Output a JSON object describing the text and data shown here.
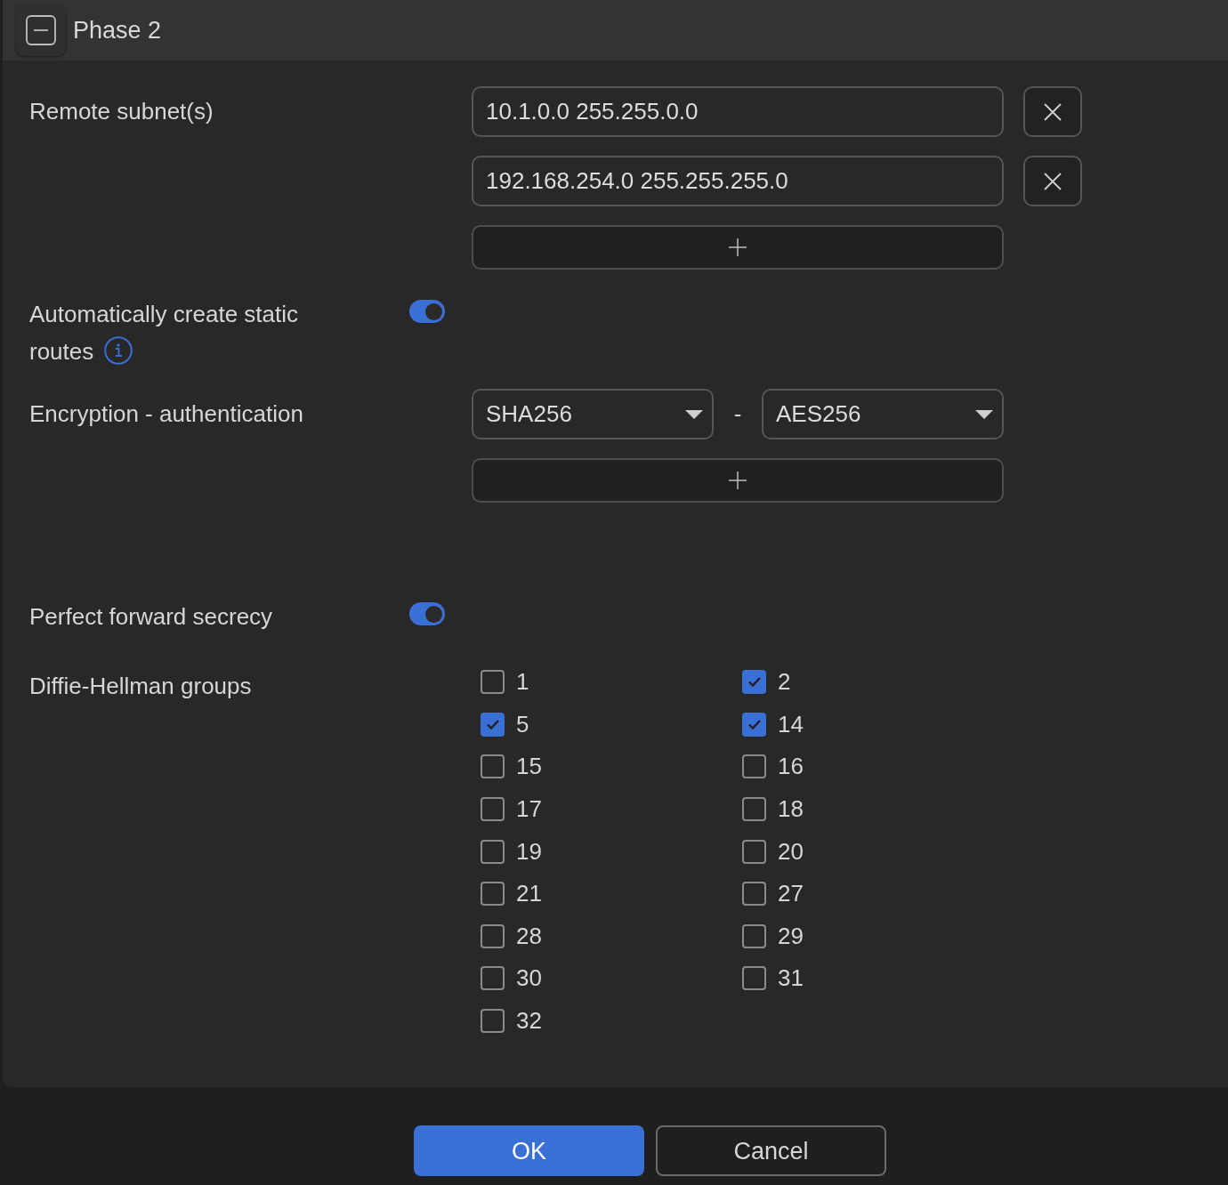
{
  "section": {
    "title": "Phase 2",
    "expanded": true
  },
  "remote_subnets": {
    "label": "Remote subnet(s)",
    "entries": [
      {
        "value": "10.1.0.0 255.255.0.0"
      },
      {
        "value": "192.168.254.0 255.255.255.0"
      }
    ]
  },
  "auto_static_routes": {
    "label": "Automatically create static routes",
    "on": true
  },
  "encryption_authentication": {
    "label": "Encryption - authentication",
    "entries": [
      {
        "authentication": "SHA256",
        "separator": "-",
        "encryption": "AES256"
      }
    ]
  },
  "perfect_forward_secrecy": {
    "label": "Perfect forward secrecy",
    "on": true
  },
  "dh_groups": {
    "label": "Diffie-Hellman groups",
    "options": [
      {
        "label": "1",
        "checked": false
      },
      {
        "label": "2",
        "checked": true
      },
      {
        "label": "5",
        "checked": true
      },
      {
        "label": "14",
        "checked": true
      },
      {
        "label": "15",
        "checked": false
      },
      {
        "label": "16",
        "checked": false
      },
      {
        "label": "17",
        "checked": false
      },
      {
        "label": "18",
        "checked": false
      },
      {
        "label": "19",
        "checked": false
      },
      {
        "label": "20",
        "checked": false
      },
      {
        "label": "21",
        "checked": false
      },
      {
        "label": "27",
        "checked": false
      },
      {
        "label": "28",
        "checked": false
      },
      {
        "label": "29",
        "checked": false
      },
      {
        "label": "30",
        "checked": false
      },
      {
        "label": "31",
        "checked": false
      },
      {
        "label": "32",
        "checked": false
      }
    ]
  },
  "buttons": [
    {
      "label": "OK",
      "kind": "primary"
    },
    {
      "label": "Cancel",
      "kind": "secondary"
    }
  ]
}
